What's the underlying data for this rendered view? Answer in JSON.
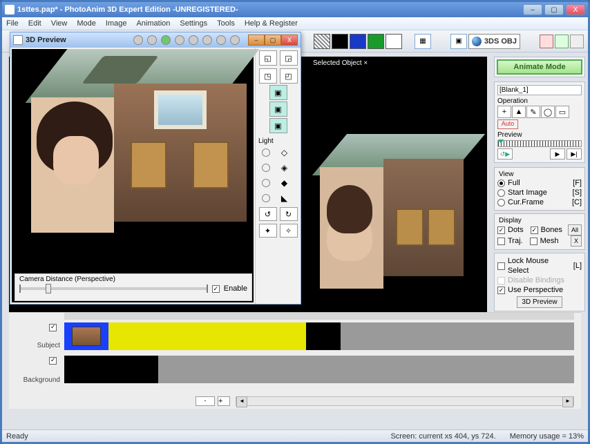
{
  "window": {
    "title": "1sttes.pap* - PhotoAnim 3D Expert Edition -UNREGISTERED-",
    "min": "–",
    "max": "▢",
    "close": "X"
  },
  "menu": [
    "File",
    "Edit",
    "View",
    "Mode",
    "Image",
    "Animation",
    "Settings",
    "Tools",
    "Help & Register"
  ],
  "toolbar": {
    "threeds": "3DS OBJ"
  },
  "stage": {
    "tabLabel": "Selected Object ×"
  },
  "preview": {
    "title": "3D Preview",
    "lightLabel": "Light",
    "camLabel": "Camera Distance (Perspective)",
    "enable": "Enable"
  },
  "panel": {
    "animateBtn": "Animate Mode",
    "objectName": "[Blank_1]",
    "operationLabel": "Operation",
    "auto": "Auto",
    "previewLabel": "Preview",
    "view": {
      "label": "View",
      "full": "Full",
      "fullKey": "[F]",
      "startImage": "Start Image",
      "startKey": "[S]",
      "curFrame": "Cur.Frame",
      "curKey": "[C]"
    },
    "display": {
      "label": "Display",
      "dots": "Dots",
      "bones": "Bones",
      "all": "All",
      "traj": "Traj.",
      "mesh": "Mesh",
      "x": "X"
    },
    "lockMouse": "Lock Mouse Select",
    "lockKey": "[L]",
    "disableBindings": "Disable Bindings",
    "usePerspective": "Use Perspective",
    "preview3dBtn": "3D Preview"
  },
  "timeline": {
    "subject": "Subject",
    "background": "Background",
    "navMinus": "-",
    "navPlus": "+"
  },
  "status": {
    "ready": "Ready",
    "screen": "Screen: current xs 404, ys 724.",
    "memory": "Memory usage = 13%"
  }
}
